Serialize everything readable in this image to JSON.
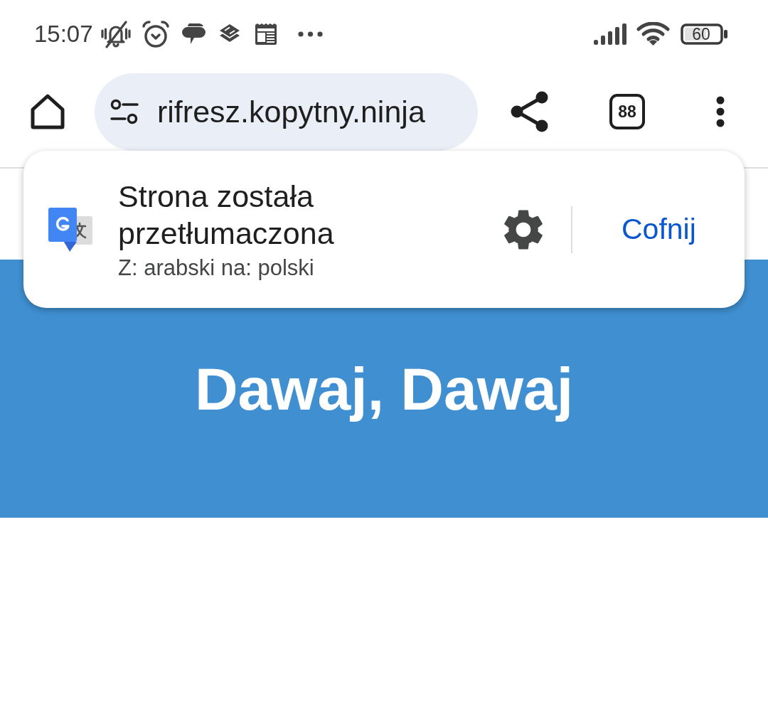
{
  "status_bar": {
    "time": "15:07",
    "battery": "60"
  },
  "toolbar": {
    "url": "rifresz.kopytny.ninja",
    "tab_count": "88"
  },
  "translate_bar": {
    "title": "Strona została przetłumaczona",
    "subtitle": "Z: arabski na: polski",
    "action": "Cofnij"
  },
  "page": {
    "heading": "Dawaj, Dawaj"
  }
}
